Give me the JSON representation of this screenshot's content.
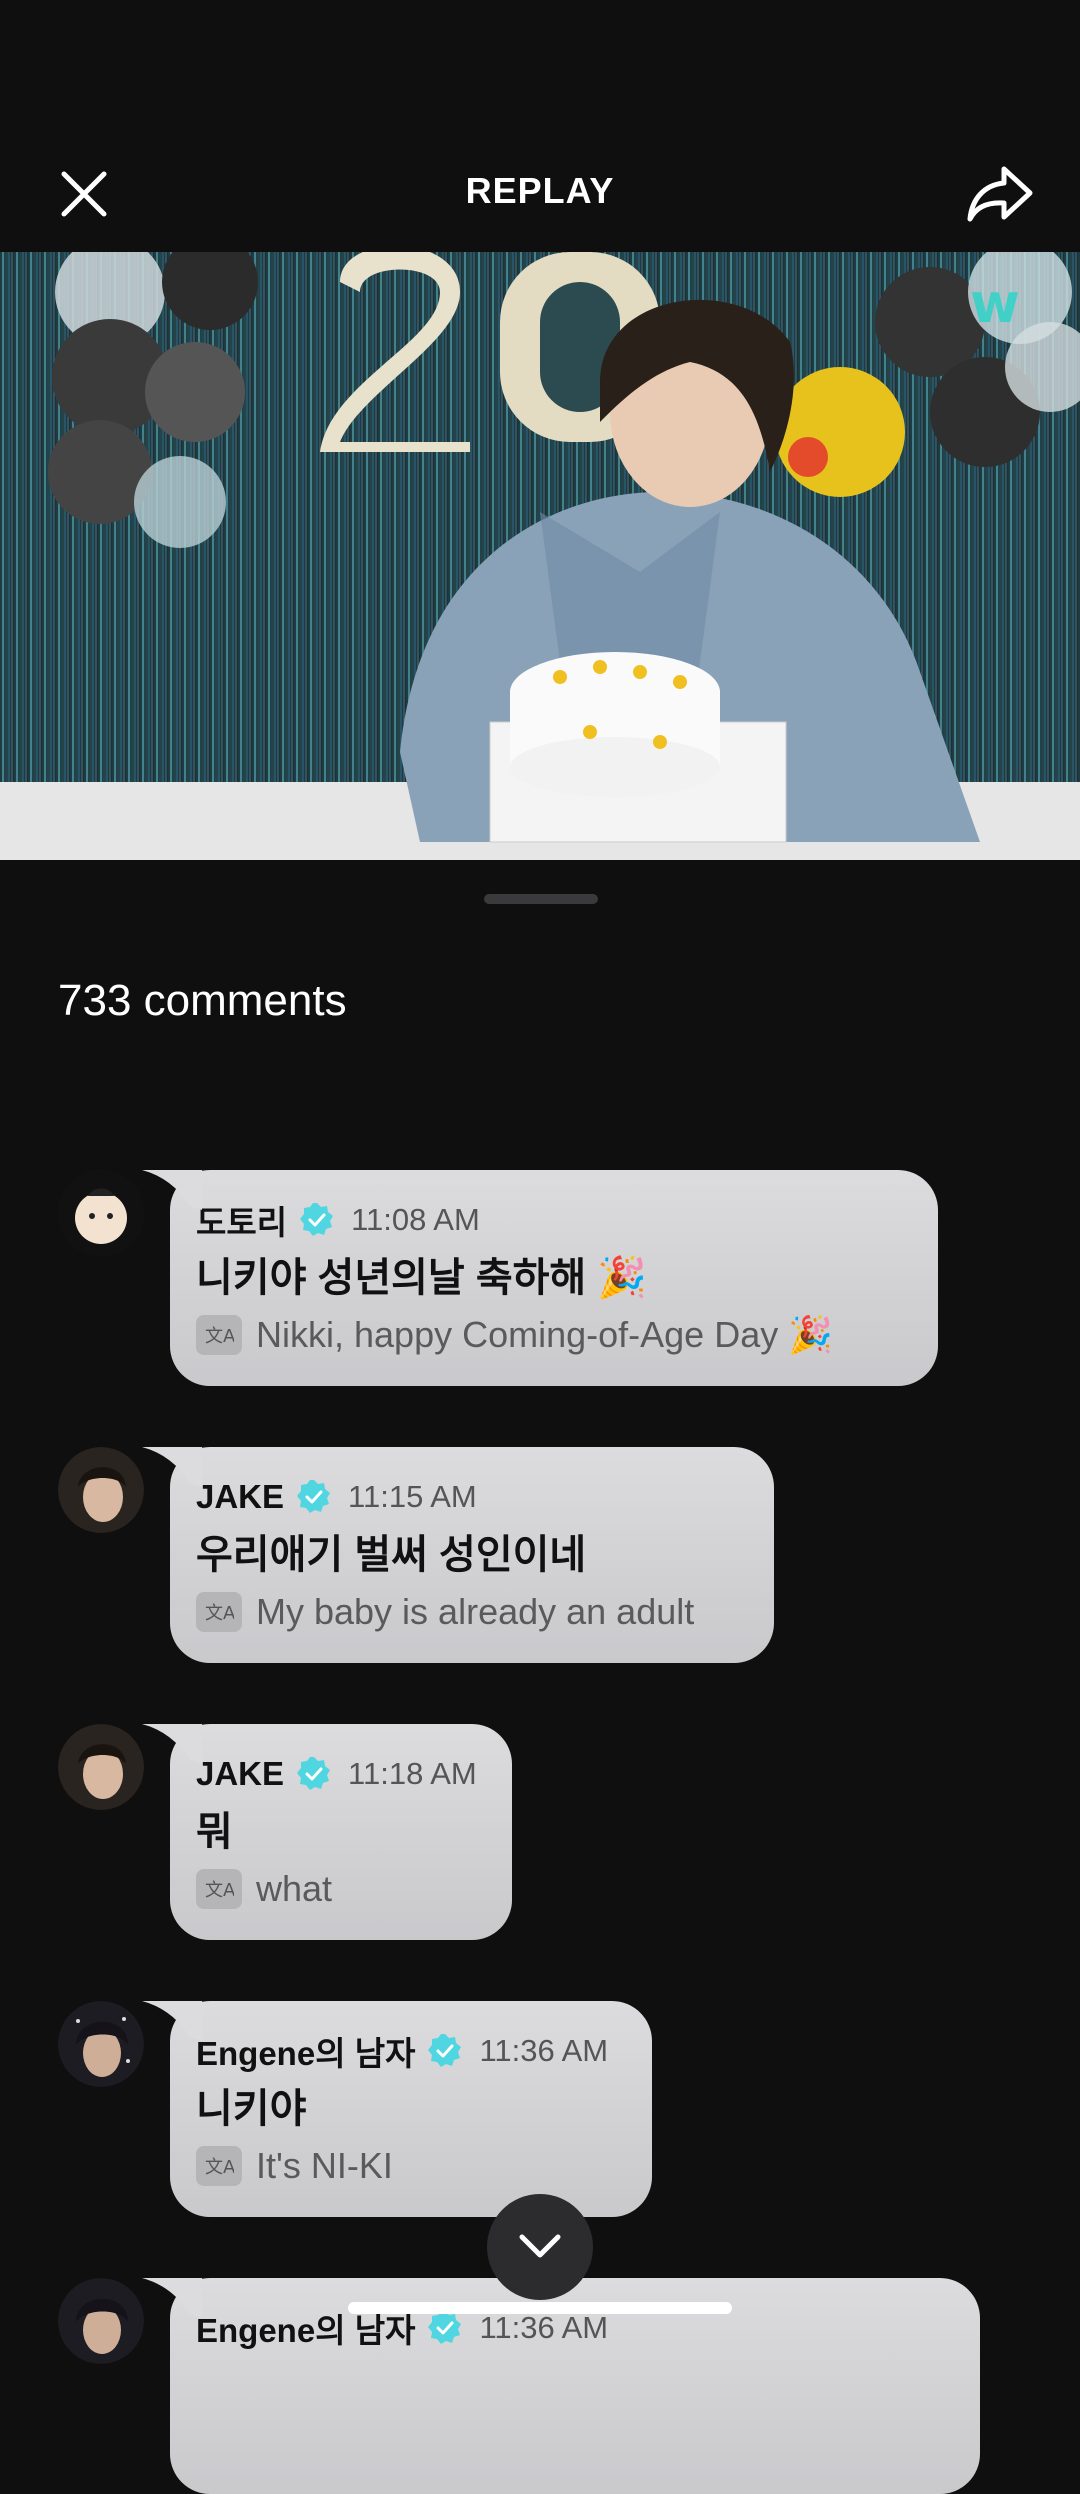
{
  "header": {
    "title": "REPLAY",
    "close_icon": "close-icon",
    "share_icon": "share-icon"
  },
  "video": {
    "progress_fraction": 0.01,
    "accent_color": "#2fd3c8",
    "balloon_digits": "20"
  },
  "comments_section": {
    "count_label": "733 comments"
  },
  "comments": [
    {
      "author": "도토리",
      "time": "11:08 AM",
      "message": "니키야 성년의날 축하해 🎉",
      "translation": "Nikki, happy Coming-of-Age Day 🎉"
    },
    {
      "author": "JAKE",
      "time": "11:15 AM",
      "message": "우리애기 벌써 성인이네",
      "translation": "My baby is already an adult"
    },
    {
      "author": "JAKE",
      "time": "11:18 AM",
      "message": "뭐",
      "translation": "what"
    },
    {
      "author": "Engene의 남자",
      "time": "11:36 AM",
      "message": "니키야",
      "translation": "It's NI-KI"
    },
    {
      "author": "Engene의 남자",
      "time": "11:36 AM",
      "message": "",
      "translation": ""
    }
  ],
  "colors": {
    "background": "#0f0f10",
    "bubble": "#d6d6d8",
    "verified": "#4fd6e0"
  }
}
